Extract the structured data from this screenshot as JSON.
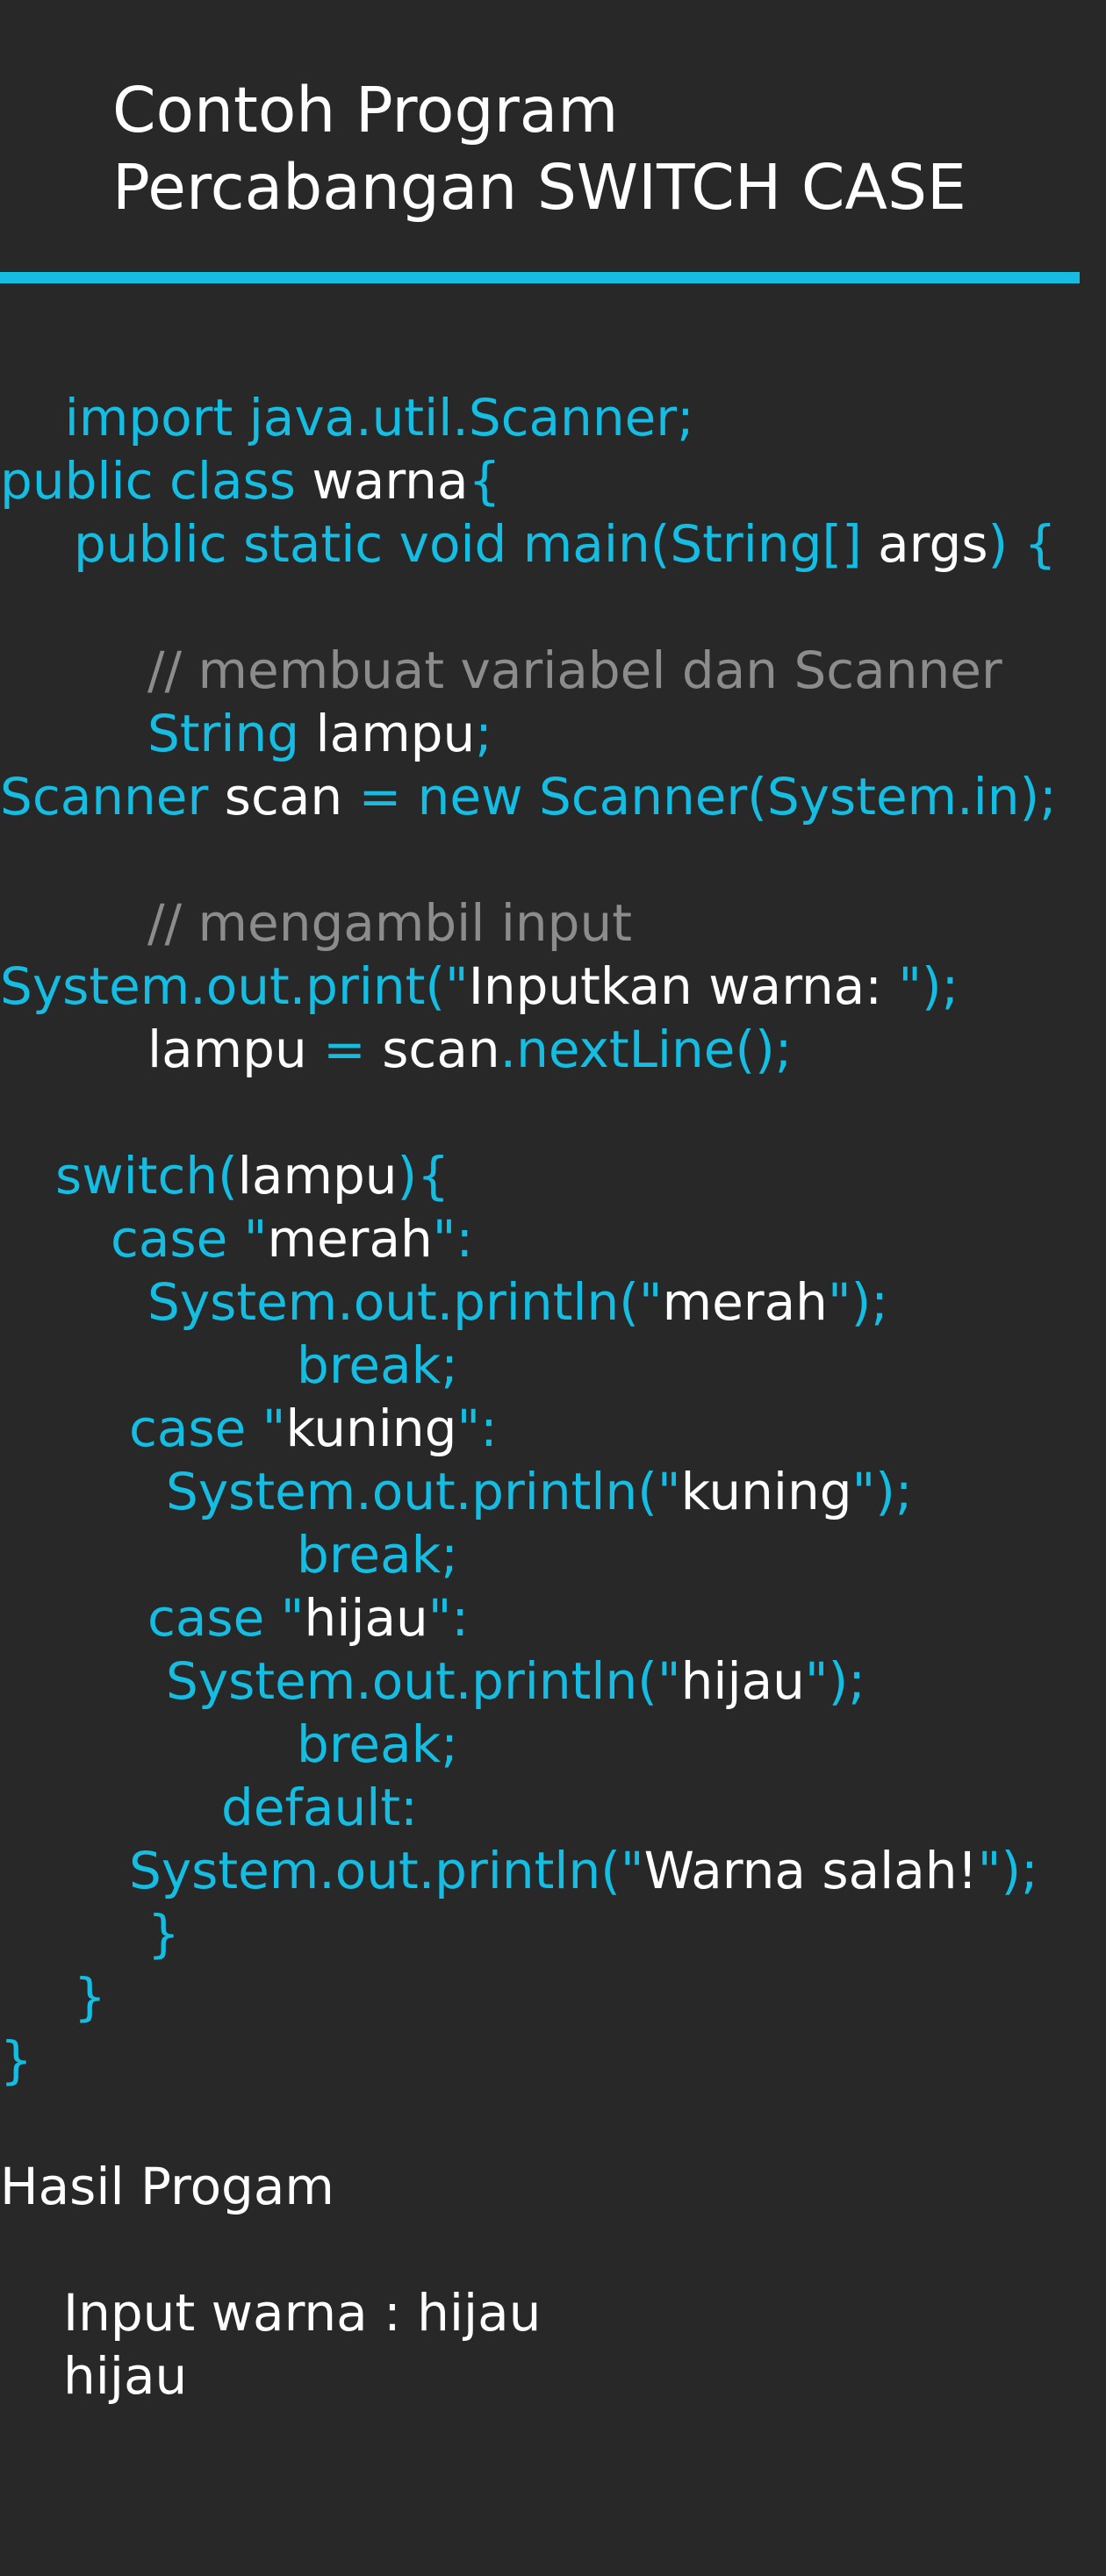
{
  "title": {
    "line1": "Contoh Program",
    "line2": "Percabangan SWITCH CASE"
  },
  "colors": {
    "background": "#282828",
    "keyword": "#14bde1",
    "identifier": "#ffffff",
    "comment": "#8c8c8c",
    "divider": "#14bde1"
  },
  "code": {
    "l01": "import java.util.Scanner;",
    "l02a": "public class ",
    "l02b": "warna",
    "l02c": "{",
    "l03a": "public static void main(String[] ",
    "l03b": "args",
    "l03c": ") {",
    "l04": "// membuat variabel dan Scanner",
    "l05a": "String ",
    "l05b": "lampu",
    "l05c": ";",
    "l06a": "Scanner ",
    "l06b": "scan",
    "l06c": " = new Scanner(System.in);",
    "l07": "// mengambil input",
    "l08a": "System.out.print(\"",
    "l08b": "Inputkan warna: ",
    "l08c": "\");",
    "l09a": "lampu",
    "l09b": " = ",
    "l09c": "scan",
    "l09d": ".nextLine();",
    "l10a": "switch(",
    "l10b": "lampu",
    "l10c": "){",
    "l11a": "case \"",
    "l11b": "merah",
    "l11c": "\":",
    "l12a": "System.out.println(\"",
    "l12b": "merah",
    "l12c": "\");",
    "l13": "break;",
    "l14a": "case \"",
    "l14b": "kuning",
    "l14c": "\":",
    "l15a": "System.out.println(\"",
    "l15b": "kuning",
    "l15c": "\");",
    "l16": "break;",
    "l17a": "case \"",
    "l17b": "hijau",
    "l17c": "\":",
    "l18a": "System.out.println(\"",
    "l18b": "hijau",
    "l18c": "\");",
    "l19": "break;",
    "l20": "default:",
    "l21a": "System.out.println(\"",
    "l21b": "Warna salah!",
    "l21c": "\");",
    "l22": "}",
    "l23": "}",
    "l24": "}"
  },
  "output": {
    "heading": "Hasil Progam",
    "line1": "Input warna : hijau",
    "line2": "hijau"
  }
}
